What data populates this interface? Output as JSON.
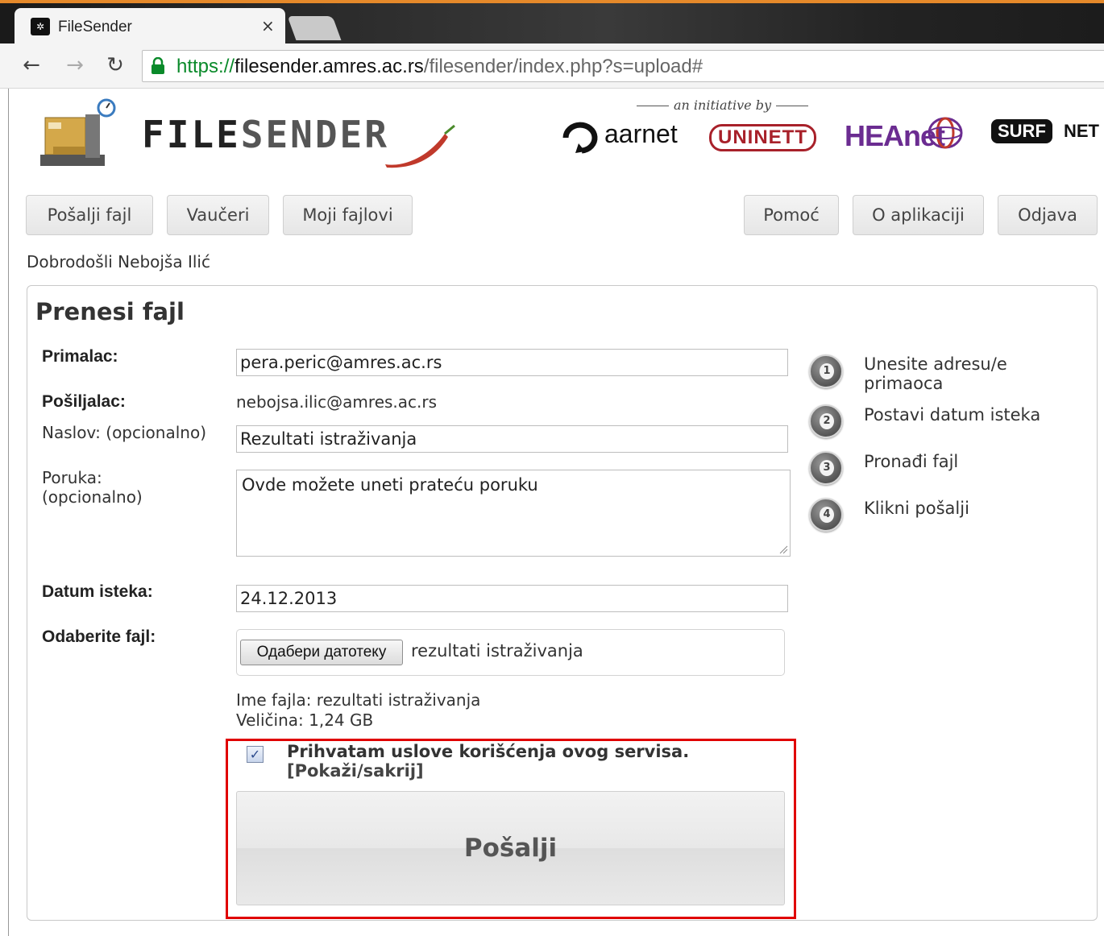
{
  "browser": {
    "tab_title": "FileSender",
    "tab_close": "×",
    "url_scheme": "https://",
    "url_host": "filesender.amres.ac.rs",
    "url_path": "/filesender/index.php?s=upload#"
  },
  "header": {
    "brand_part1": "FILE",
    "brand_part2": "SENDER",
    "initiative": "an initiative by",
    "partners": {
      "aarnet": "aarnet",
      "uninett": "UNINETT",
      "heanet": "HEAnet",
      "surf": "SURF",
      "net": "NET"
    }
  },
  "menu": {
    "send_file": "Pošalji fajl",
    "vouchers": "Vaučeri",
    "my_files": "Moji fajlovi",
    "help": "Pomoć",
    "about": "O aplikaciji",
    "logout": "Odjava"
  },
  "welcome": "Dobrodošli Nebojša Ilić",
  "form": {
    "title": "Prenesi fajl",
    "recipient_label": "Primalac:",
    "recipient_value": "pera.peric@amres.ac.rs",
    "sender_label": "Pošiljalac:",
    "sender_value": "nebojsa.ilic@amres.ac.rs",
    "subject_label": "Naslov: (opcionalno)",
    "subject_value": "Rezultati istraživanja",
    "message_label_1": "Poruka:",
    "message_label_2": "(opcionalno)",
    "message_value": "Ovde možete uneti prateću poruku",
    "expiry_label": "Datum isteka:",
    "expiry_value": "24.12.2013",
    "file_label": "Odaberite fajl:",
    "file_button": "Одабери датотеку",
    "file_chosen": "rezultati istraživanja",
    "file_name_info": "Ime fajla: rezultati istraživanja",
    "file_size_info": "Veličina: 1,24 GB",
    "terms_checked": "✓",
    "terms_text": "Prihvatam uslove korišćenja ovog servisa.",
    "terms_toggle": "[Pokaži/sakrij]",
    "send_button": "Pošalji"
  },
  "steps": [
    {
      "num": "1",
      "text": "Unesite adresu/e primaoca"
    },
    {
      "num": "2",
      "text": "Postavi datum isteka"
    },
    {
      "num": "3",
      "text": "Pronađi fajl"
    },
    {
      "num": "4",
      "text": "Klikni pošalji"
    }
  ],
  "colors": {
    "highlight": "#e00000",
    "url_scheme": "#0a8a2a",
    "heanet": "#6b2c91",
    "uninett": "#a8212a",
    "chrome_accent": "#e5892a"
  }
}
